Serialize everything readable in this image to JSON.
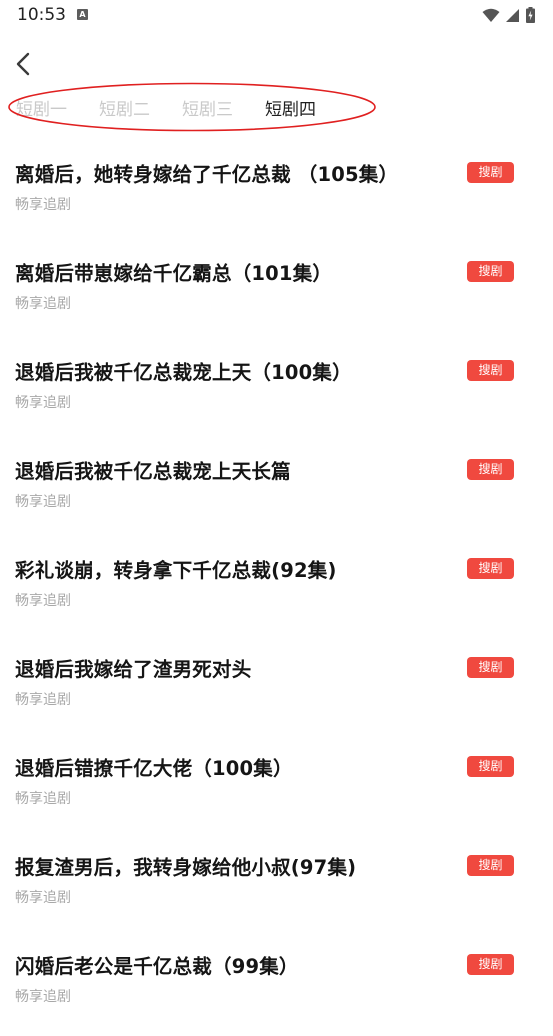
{
  "status_bar": {
    "time": "10:53",
    "notification_icon_letter": "A",
    "icons": [
      "wifi-icon",
      "cell-signal-icon",
      "battery-charging-icon"
    ]
  },
  "nav": {
    "back_icon": "chevron-left-icon"
  },
  "tabs": [
    {
      "label": "短剧一",
      "active": false
    },
    {
      "label": "短剧二",
      "active": false
    },
    {
      "label": "短剧三",
      "active": false
    },
    {
      "label": "短剧四",
      "active": true
    }
  ],
  "annotation": {
    "shape": "ellipse",
    "color": "#e02020"
  },
  "list": {
    "items": [
      {
        "title": "离婚后，她转身嫁给了千亿总裁 （105集）",
        "subtitle": "畅享追剧",
        "action": "搜剧"
      },
      {
        "title": "离婚后带崽嫁给千亿霸总（101集）",
        "subtitle": "畅享追剧",
        "action": "搜剧"
      },
      {
        "title": "退婚后我被千亿总裁宠上天（100集）",
        "subtitle": "畅享追剧",
        "action": "搜剧"
      },
      {
        "title": "退婚后我被千亿总裁宠上天长篇",
        "subtitle": "畅享追剧",
        "action": "搜剧"
      },
      {
        "title": "彩礼谈崩，转身拿下千亿总裁(92集)",
        "subtitle": "畅享追剧",
        "action": "搜剧"
      },
      {
        "title": "退婚后我嫁给了渣男死对头",
        "subtitle": "畅享追剧",
        "action": "搜剧"
      },
      {
        "title": "退婚后错撩千亿大佬（100集）",
        "subtitle": "畅享追剧",
        "action": "搜剧"
      },
      {
        "title": "报复渣男后，我转身嫁给他小叔(97集)",
        "subtitle": "畅享追剧",
        "action": "搜剧"
      },
      {
        "title": "闪婚后老公是千亿总裁（99集）",
        "subtitle": "畅享追剧",
        "action": "搜剧"
      }
    ]
  },
  "colors": {
    "accent": "#f0493f",
    "tab_inactive": "#c9c9c9",
    "subtitle": "#a8a8a8"
  }
}
